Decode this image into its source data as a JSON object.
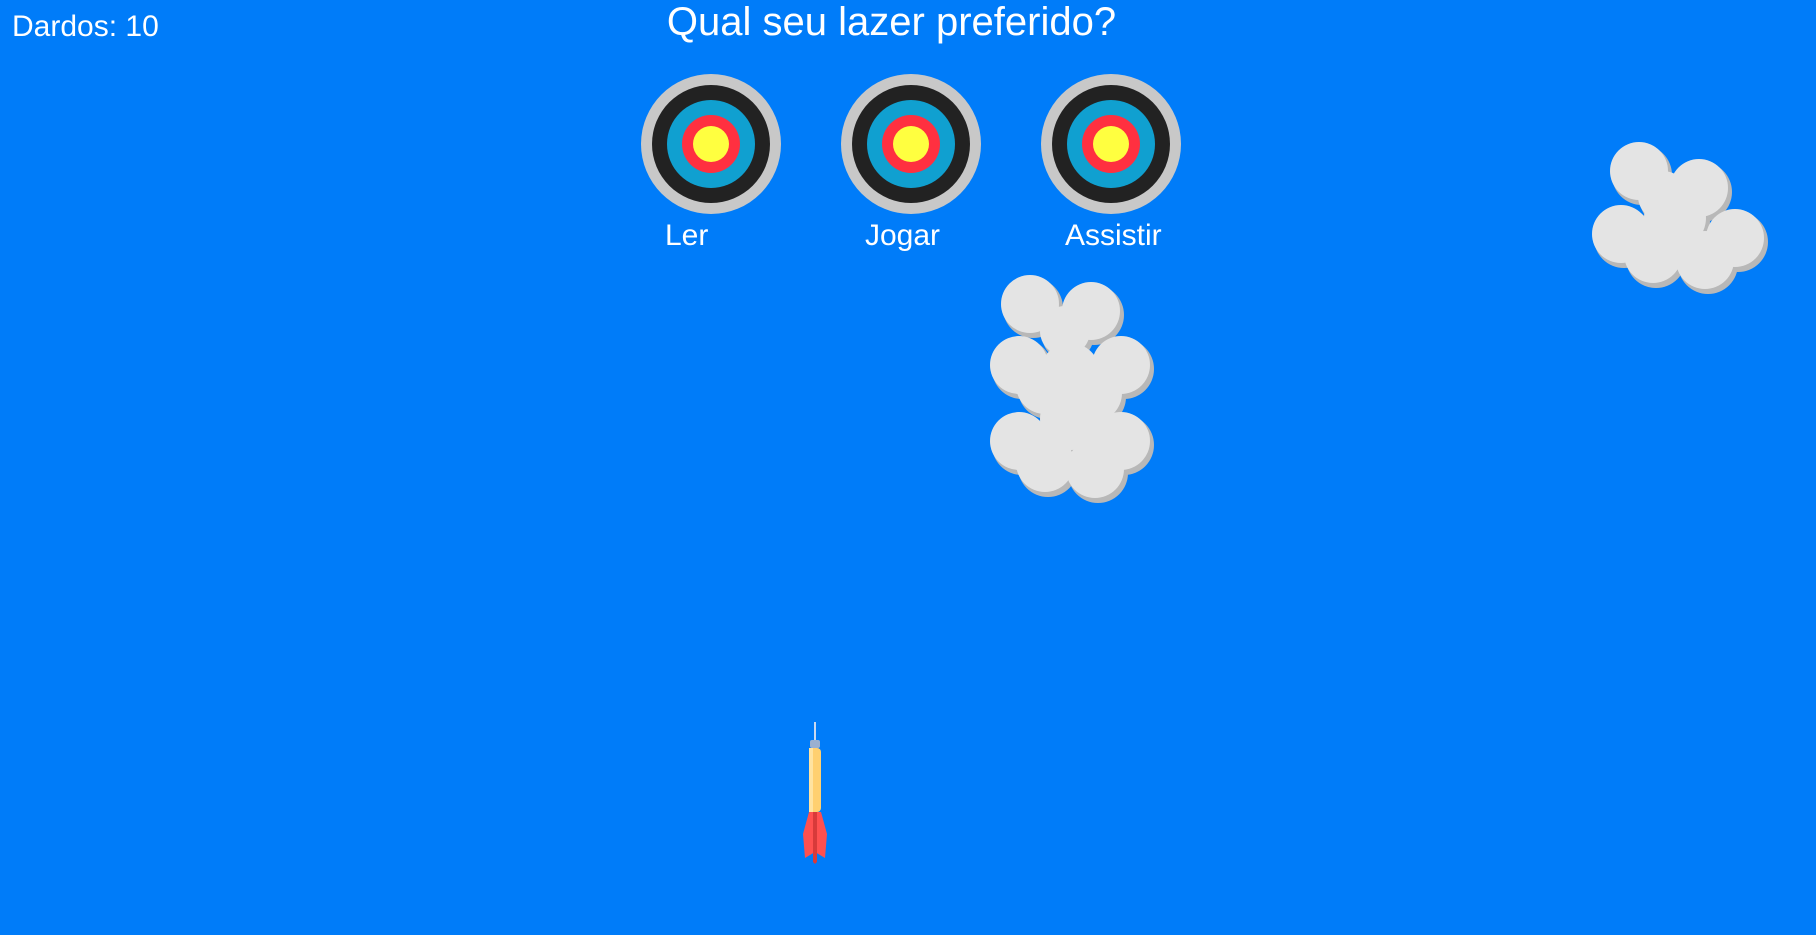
{
  "hud": {
    "darts_label": "Dardos: 10"
  },
  "question": {
    "text": "Qual seu lazer preferido?"
  },
  "targets": [
    {
      "label": "Ler"
    },
    {
      "label": "Jogar"
    },
    {
      "label": "Assistir"
    }
  ],
  "colors": {
    "sky": "#007cf9",
    "target_outer": "#c8c8c8",
    "target_black": "#222222",
    "target_blue": "#10a0d0",
    "target_red": "#ff3040",
    "target_yellow": "#ffff40",
    "cloud_fill": "#e4e4e4",
    "cloud_shadow": "#b8b8b8",
    "dart_shaft": "#ffd070",
    "dart_flight": "#ff5050",
    "dart_tip": "#9ab0d0"
  },
  "icons": {
    "target": "bullseye-target-icon",
    "cloud": "cloud-icon",
    "dart": "dart-icon"
  }
}
